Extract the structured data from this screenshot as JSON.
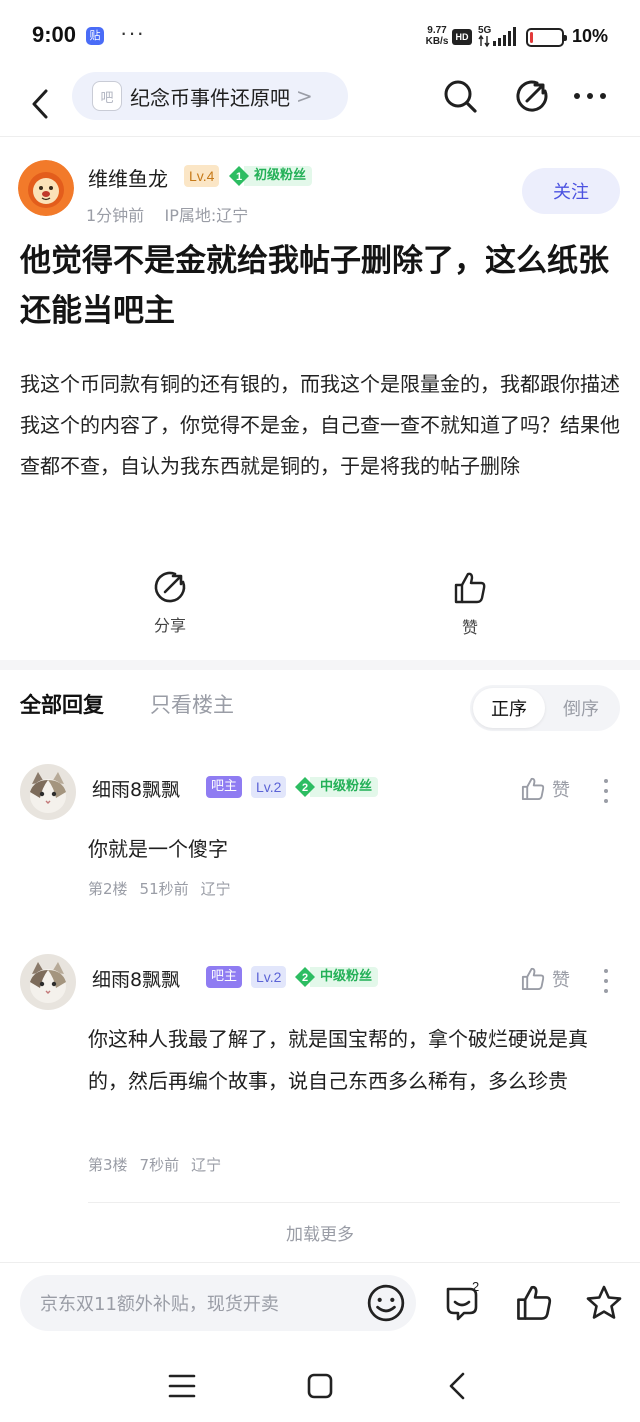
{
  "status_bar": {
    "time": "9:00",
    "app_badge": "贴",
    "dots": "···",
    "net_speed_value": "9.77",
    "net_speed_unit": "KB/s",
    "hd": "HD",
    "network": "5G",
    "battery_pct": "10%",
    "battery_level": 0.1
  },
  "header": {
    "forum_icon_text": "吧",
    "forum_name": "纪念币事件还原吧",
    "chevron": ">"
  },
  "post": {
    "author": {
      "name": "维维鱼龙",
      "level": "Lv.4",
      "fan_rank": "1",
      "fan_title": "初级粉丝",
      "time": "1分钟前",
      "ip": "IP属地:辽宁"
    },
    "follow_label": "关注",
    "title": "他觉得不是金就给我帖子删除了，这么纸张还能当吧主",
    "body": "我这个币同款有铜的还有银的，而我这个是限量金的，我都跟你描述我这个的内容了，你觉得不是金，自己查一查不就知道了吗？结果他查都不查，自认为我东西就是铜的，于是将我的帖子删除",
    "actions": {
      "share_label": "分享",
      "like_label": "赞"
    }
  },
  "replies": {
    "tab_all": "全部回复",
    "tab_owner_only": "只看楼主",
    "sort_asc": "正序",
    "sort_desc": "倒序",
    "items": [
      {
        "name": "细雨8飘飘",
        "owner_badge": "吧主",
        "level": "Lv.2",
        "fan_rank": "2",
        "fan_title": "中级粉丝",
        "like_label": "赞",
        "text": "你就是一个傻字",
        "floor": "第2楼",
        "time": "51秒前",
        "location": "辽宁"
      },
      {
        "name": "细雨8飘飘",
        "owner_badge": "吧主",
        "level": "Lv.2",
        "fan_rank": "2",
        "fan_title": "中级粉丝",
        "like_label": "赞",
        "text": "你这种人我最了解了，就是国宝帮的，拿个破烂硬说是真的，然后再编个故事，说自己东西多么稀有，多么珍贵",
        "floor": "第3楼",
        "time": "7秒前",
        "location": "辽宁"
      }
    ],
    "load_more": "加载更多"
  },
  "bottom_bar": {
    "input_placeholder": "京东双11额外补贴，现货开卖",
    "reply_count": "2"
  },
  "colors": {
    "accent": "#4b52e0",
    "fan_green": "#23b057",
    "owner_purple": "#8f7cf2",
    "muted": "#9a9da6"
  }
}
